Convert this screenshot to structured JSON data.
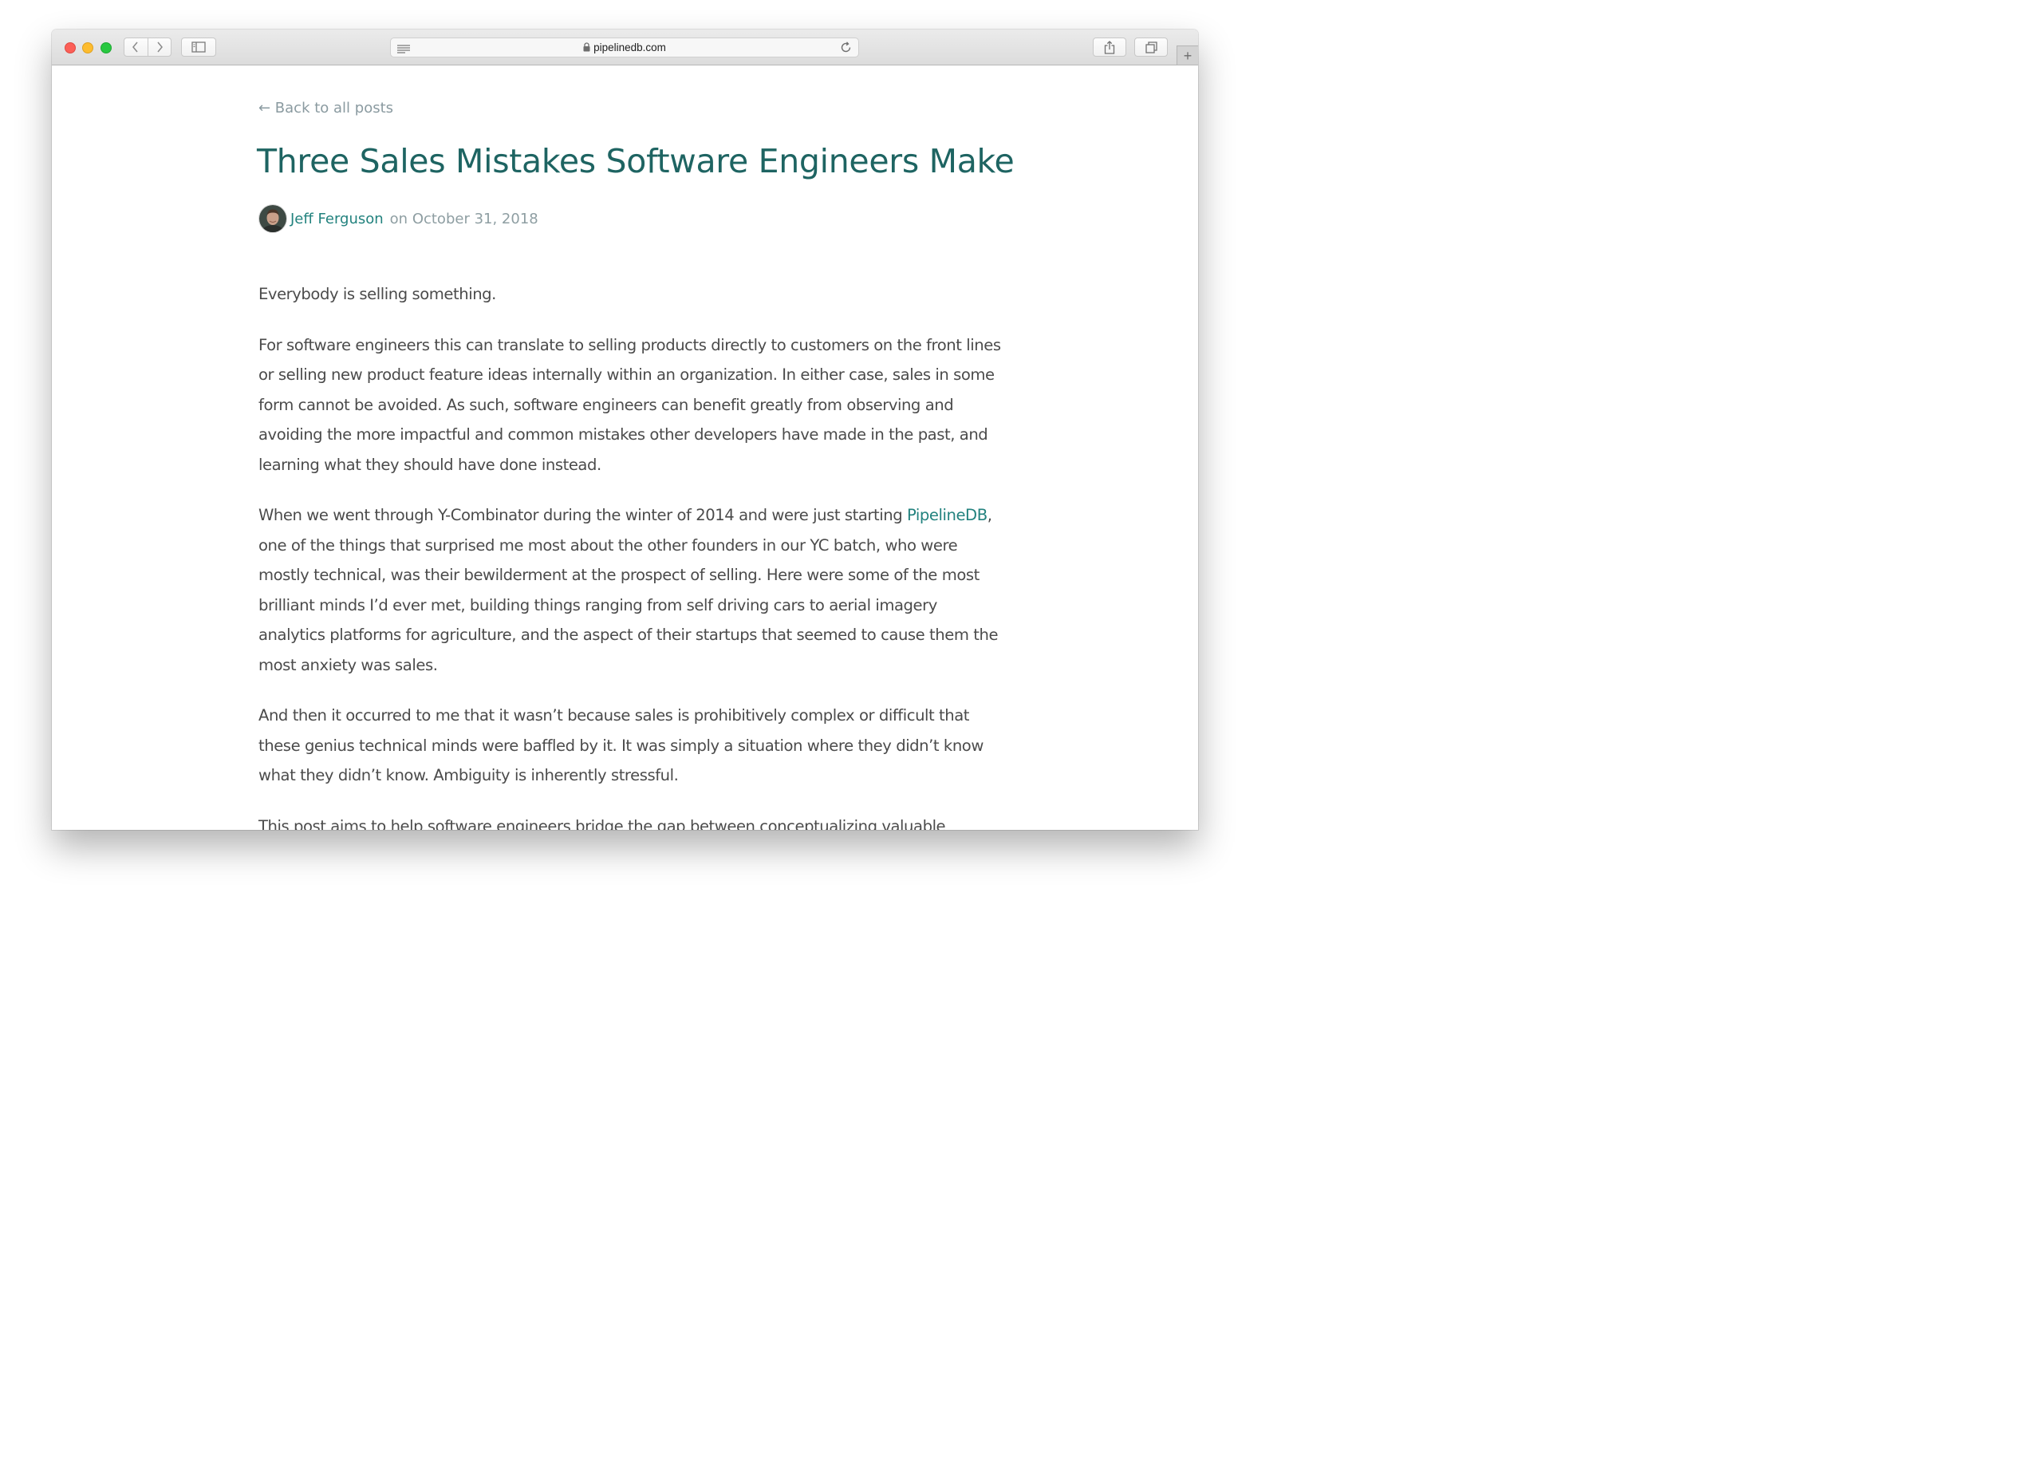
{
  "browser": {
    "url": "pipelinedb.com"
  },
  "colors": {
    "title": "#1e6462",
    "link": "#22827e",
    "muted": "#8e9ea2",
    "body": "#4b4b4b"
  },
  "article": {
    "back_label": "← Back to all posts",
    "title": "Three Sales Mistakes Software Engineers Make",
    "author": "Jeff Ferguson",
    "date": "on October 31, 2018",
    "paragraphs": [
      "Everybody is selling something.",
      "For software engineers this can translate to selling products directly to customers on the front lines or selling new product feature ideas internally within an organization. In either case, sales in some form cannot be avoided. As such, software engineers can benefit greatly from observing and avoiding the more impactful and common mistakes other developers have made in the past, and learning what they should have done instead.",
      "When we went through Y-Combinator during the winter of 2014 and were just starting ",
      "PipelineDB",
      ", one of the things that surprised me most about the other founders in our YC batch, who were mostly technical, was their bewilderment at the prospect of selling. Here were some of the most brilliant minds I’d ever met, building things ranging from self driving cars to aerial imagery analytics platforms for agriculture, and the aspect of their startups that seemed to cause them the most anxiety was sales.",
      "And then it occurred to me that it wasn’t because sales is prohibitively complex or difficult that these genius technical minds were baffled by it. It was simply a situation where they didn’t know what they didn’t know. Ambiguity is inherently stressful.",
      "This post aims to help software engineers bridge the gap between conceptualizing valuable"
    ]
  }
}
